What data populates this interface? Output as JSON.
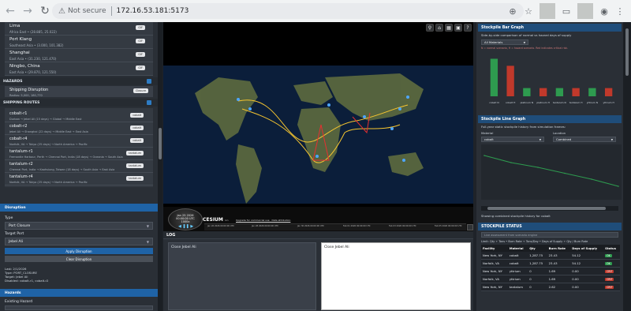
{
  "browser": {
    "security_label": "Not secure",
    "url": "172.16.53.181:5173",
    "icons": [
      "back-icon",
      "forward-icon",
      "reload-icon",
      "zoom-icon",
      "bookmark-star-icon",
      "tab-search-icon",
      "profile-icon",
      "menu-icon"
    ]
  },
  "ports": [
    {
      "name": "Lima",
      "sub": "Africa East • (28.885, 25.022)",
      "badge": "GIF"
    },
    {
      "name": "Port Klang",
      "sub": "Southeast Asia • (3.000, 101.382)",
      "badge": "GIF"
    },
    {
      "name": "Shanghai",
      "sub": "East Asia • (31.230, 121.470)",
      "badge": "GIF"
    },
    {
      "name": "Ningbo, China",
      "sub": "East Asia • (29.870, 121.550)",
      "badge": "GIF"
    }
  ],
  "hazards_section": {
    "title": "HAZARDS",
    "item": {
      "name": "Shipping Disruption",
      "sub": "Radius: 5,000, 180,770",
      "badge": "Closure"
    }
  },
  "routes_section": {
    "title": "SHIPPING ROUTES",
    "routes": [
      {
        "name": "cobalt-r1",
        "sub": "Durban → Jebel Ali (15 days) → Global → Middle East",
        "badge": "cobalt"
      },
      {
        "name": "cobalt-r2",
        "sub": "Jebel Ali → Shanghai (22 days) → Middle East → East Asia",
        "badge": "cobalt"
      },
      {
        "name": "cobalt-r4",
        "sub": "Norfolk, VA → Tokyo (25 days) → North America → Pacific",
        "badge": "cobalt"
      },
      {
        "name": "tantalum-r1",
        "sub": "Fremantle Harbour, Perth → Chennai Port, India (18 days) → Oceania → South Asia",
        "badge": "tantalum"
      },
      {
        "name": "tantalum-r2",
        "sub": "Chennai Port, India → Kaohsiung, Taiwan (18 days) → South Asia → East Asia",
        "badge": "tantalum"
      },
      {
        "name": "tantalum-r4",
        "sub": "Norfolk, VA → Tokyo (25 days) → North America → Pacific",
        "badge": "tantalum"
      }
    ]
  },
  "disruption": {
    "title": "Disruption",
    "type_label": "Type",
    "type_value": "Port Closure",
    "target_label": "Target Port",
    "target_value": "Jebel Ali",
    "apply_label": "Apply Disruption",
    "clear_label": "Clear Disruption",
    "last_lines": [
      "Last: 2/1/2026",
      "Type: PORT_CLOSURE",
      "Target: Jebel Ali",
      "Disabled: cobalt-r1, cobalt-r2"
    ]
  },
  "hazards_panel": {
    "title": "Hazards",
    "existing_label": "Existing Hazard"
  },
  "timeline": {
    "date": "Jan 25 2026",
    "time": "00:00:00 UTC",
    "speed": "1000x",
    "cesium": "CESIUM",
    "ion": "ion",
    "credit": "Upgrade for commercial use · Data attribution",
    "ticks": [
      "Jan 26 2026 00:00:00 UTC",
      "Jan 28 2026 00:00:00 UTC",
      "Jan 30 2026 00:00:00 UTC",
      "Feb 01 2026 00:00:00 UTC",
      "Feb 03 2026 00:00:00 UTC",
      "Feb 05 2026 00:00:00 UTC"
    ]
  },
  "log": {
    "title": "LOG",
    "left_text": "Close Jebel Ali",
    "right_text": "Close Jebel Ali"
  },
  "bar_card": {
    "title": "Stockpile Bar Graph",
    "desc": "Side-by-side comparison of normal vs hazard days of supply",
    "select": "All Materials",
    "note": "N = normal scenario, H = hazard scenario. Red indicates critical risk."
  },
  "line_card": {
    "title": "Stockpile Line Graph",
    "desc": "Full-year static stockpile history from simulation frames:",
    "material_label": "Material",
    "material_value": "cobalt",
    "location_label": "Location",
    "location_value": "Combined",
    "caption": "Showing combined stockpile history for cobalt"
  },
  "chart_data": [
    {
      "type": "bar",
      "title": "",
      "categories": [
        "cobalt N",
        "cobalt H",
        "platinum N",
        "platinum H",
        "tantalum N",
        "tantalum H",
        "yttrium N",
        "yttrium H"
      ],
      "series": [
        {
          "values": [
            64,
            52,
            14,
            14,
            14,
            14,
            14,
            14
          ]
        }
      ],
      "ylim": [
        0,
        70
      ]
    },
    {
      "type": "line",
      "title": "",
      "x": [
        0,
        1,
        2,
        3,
        4,
        5
      ],
      "series": [
        {
          "values": [
            100,
            82,
            70,
            55,
            40,
            22
          ]
        }
      ],
      "ylim": [
        0,
        120
      ]
    }
  ],
  "status_card": {
    "title": "STOCKPILE STATUS",
    "search_placeholder": "Live assessment from scenario engine",
    "legend": "Limit: Qty ÷ Tons • Burn Rate ÷ Tons/Day • Days of Supply ÷ Qty / Burn Rate",
    "headers": [
      "Facility",
      "Material",
      "Qty",
      "Burn Rate",
      "Days of Supply",
      "Status"
    ],
    "rows": [
      [
        "New York, NY",
        "cobalt",
        "1,287.75",
        "23.43",
        "54.12",
        "OK"
      ],
      [
        "Norfolk, VA",
        "cobalt",
        "1,287.75",
        "23.43",
        "54.12",
        "OK"
      ],
      [
        "New York, NY",
        "yttrium",
        "0",
        "1.69",
        "0.00",
        "CRIT"
      ],
      [
        "Norfolk, VA",
        "yttrium",
        "0",
        "1.69",
        "0.00",
        "CRIT"
      ],
      [
        "New York, NY",
        "tantalum",
        "0",
        "2.62",
        "0.00",
        "CRIT"
      ]
    ]
  },
  "colors": {
    "accent": "#1f63a6",
    "ok": "#2e9b4f",
    "crit": "#c0392b",
    "route_yellow": "#f4c430",
    "route_red": "#e53030"
  }
}
